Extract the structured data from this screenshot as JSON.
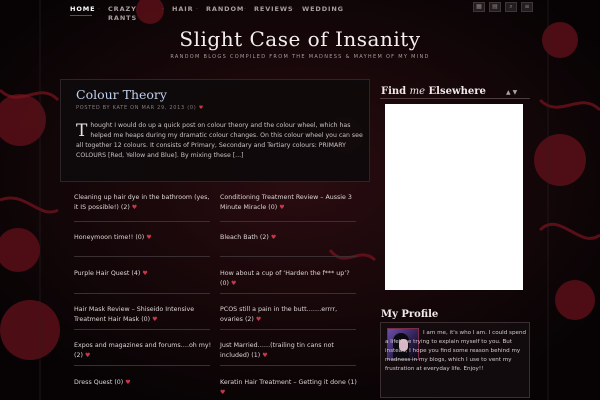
{
  "nav": {
    "items": [
      "HOME",
      "CRAZY RANTS",
      "HAIR",
      "RANDOM",
      "REVIEWS",
      "WEDDING"
    ],
    "icons": [
      "grid-icon",
      "rss-icon",
      "search-icon",
      "menu-icon"
    ]
  },
  "header": {
    "title": "Slight Case of Insanity",
    "tagline": "RANDOM BLOGS COMPILED FROM THE MADNESS & MAYHEM OF MY MIND"
  },
  "post": {
    "title": "Colour Theory",
    "meta": "POSTED BY KATE ON MAR 29, 2013 (0)",
    "dropcap": "T",
    "excerpt": "hought I would do up a quick post on colour theory and the colour wheel, which has helped me heaps during my dramatic colour changes.    On this colour wheel you can see all together 12 colours. It consists of Primary, Secondary and Tertiary colours:    PRIMARY COLOURS [Red, Yellow and Blue]. By mixing these [...]"
  },
  "links": [
    {
      "title": "Cleaning up hair dye in the bathroom (yes, it IS possible!)",
      "count": "(2)"
    },
    {
      "title": "Conditioning Treatment Review – Aussie 3 Minute Miracle",
      "count": "(0)"
    },
    {
      "title": "Honeymoon time!!",
      "count": "(0)"
    },
    {
      "title": "Bleach Bath",
      "count": "(2)"
    },
    {
      "title": "Purple Hair Quest",
      "count": "(4)"
    },
    {
      "title": "How about a cup of ‘Harden the f*** up’?",
      "count": "(0)"
    },
    {
      "title": "Hair Mask Review – Shiseido Intensive Treatment Hair Mask",
      "count": "(0)"
    },
    {
      "title": "PCOS still a pain in the butt…….errrr, ovaries",
      "count": "(2)"
    },
    {
      "title": "Expos and magazines and forums….oh my!",
      "count": "(2)"
    },
    {
      "title": "Just Married……(trailing tin cans not included)",
      "count": "(1)"
    },
    {
      "title": "Dress Quest",
      "count": "(0)"
    },
    {
      "title": "Keratin Hair Treatment – Getting it done",
      "count": "(1)"
    }
  ],
  "sidebar": {
    "find_title_prefix": "Find",
    "find_title_em": "me",
    "find_title_suffix": "Elsewhere",
    "arrows": "▲▼",
    "profile_title": "My Profile",
    "profile_text": "I am me, it's who I am. I could spend a lifetime trying to explain myself to you. But instead, I hope you find some reason behind my madness in my blogs, which I use to vent my frustration at everyday life. Enjoy!!"
  },
  "colors": {
    "accent": "#c42035",
    "background": "#0b0607",
    "post_title": "#bfd0ec"
  }
}
